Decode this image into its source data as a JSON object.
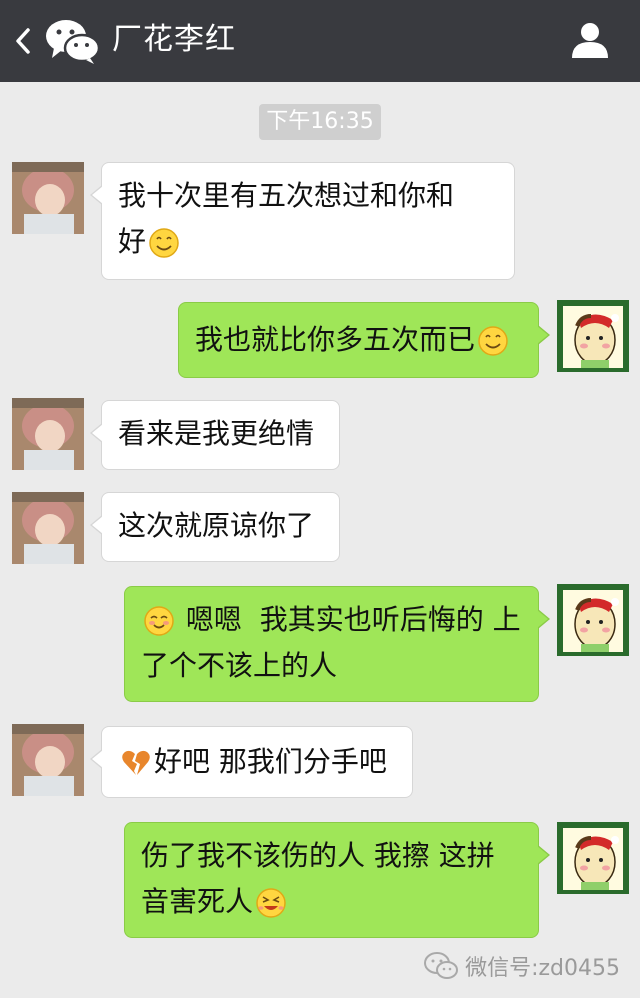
{
  "header": {
    "title": "厂花李红"
  },
  "timestamp": "下午16:35",
  "messages": [
    {
      "text1": "我十次里有五次想过和你和",
      "text2": "好"
    },
    {
      "text": "我也就比你多五次而已"
    },
    {
      "text": "看来是我更绝情"
    },
    {
      "text": "这次就原谅你了"
    },
    {
      "text1": "嗯嗯  我其实也听后悔的 上",
      "text2": "了个不该上的人"
    },
    {
      "text": "好吧 那我们分手吧"
    },
    {
      "text1": "伤了我不该伤的人 我擦 这拼",
      "text2": "音害死人"
    }
  ],
  "watermark": "微信号:zd0455",
  "colors": {
    "header_bg": "#393a3f",
    "chat_bg": "#ebebeb",
    "outgoing_bubble": "#9fe658",
    "incoming_bubble": "#ffffff"
  }
}
